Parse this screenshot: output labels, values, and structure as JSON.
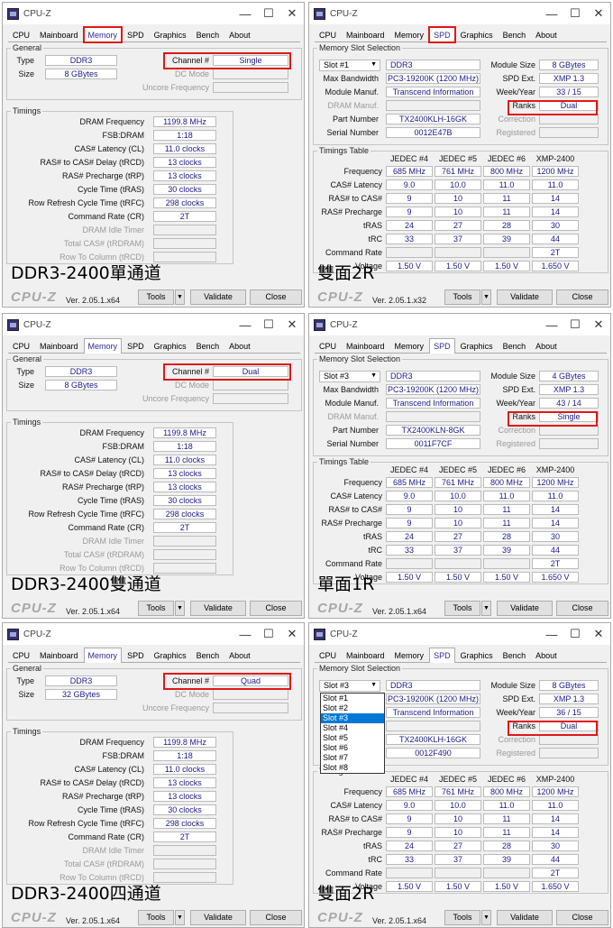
{
  "title": "CPU-Z",
  "win_controls": {
    "min": "—",
    "max": "☐",
    "close": "✕"
  },
  "tabs": [
    "CPU",
    "Mainboard",
    "Memory",
    "SPD",
    "Graphics",
    "Bench",
    "About"
  ],
  "footer": {
    "logo": "CPU-Z",
    "version": "Ver. 2.05.1.x64",
    "version_alt": "Ver. 2.05.1.x32",
    "tools": "Tools",
    "validate": "Validate",
    "close": "Close"
  },
  "mem": {
    "general": "General",
    "type_label": "Type",
    "size_label": "Size",
    "channel_label": "Channel #",
    "dc_label": "DC Mode",
    "uncore_label": "Uncore Frequency",
    "timings": "Timings",
    "t_labels": [
      "DRAM Frequency",
      "FSB:DRAM",
      "CAS# Latency (CL)",
      "RAS# to CAS# Delay (tRCD)",
      "RAS# Precharge (tRP)",
      "Cycle Time (tRAS)",
      "Row Refresh Cycle Time (tRFC)",
      "Command Rate (CR)",
      "DRAM Idle Timer",
      "Total CAS# (tRDRAM)",
      "Row To Column (tRCD)"
    ],
    "t_values": [
      "1199.8 MHz",
      "1:18",
      "11.0 clocks",
      "13 clocks",
      "13 clocks",
      "30 clocks",
      "298 clocks",
      "2T",
      "",
      "",
      ""
    ],
    "type": "DDR3",
    "panels": [
      {
        "size": "8 GBytes",
        "channel": "Single",
        "caption": "DDR3-2400單通道"
      },
      {
        "size": "8 GBytes",
        "channel": "Dual",
        "caption": "DDR3-2400雙通道"
      },
      {
        "size": "32 GBytes",
        "channel": "Quad",
        "caption": "DDR3-2400四通道"
      }
    ]
  },
  "spd": {
    "group": "Memory Slot Selection",
    "l_bw": "Max Bandwidth",
    "l_mfr": "Module Manuf.",
    "l_dram": "DRAM Manuf.",
    "l_part": "Part Number",
    "l_serial": "Serial Number",
    "l_msize": "Module Size",
    "l_ext": "SPD Ext.",
    "l_week": "Week/Year",
    "l_ranks": "Ranks",
    "l_corr": "Correction",
    "l_reg": "Registered",
    "timings": "Timings Table",
    "cols": [
      "JEDEC #4",
      "JEDEC #5",
      "JEDEC #6",
      "XMP-2400"
    ],
    "rows": [
      {
        "label": "Frequency",
        "v": [
          "685 MHz",
          "761 MHz",
          "800 MHz",
          "1200 MHz"
        ]
      },
      {
        "label": "CAS# Latency",
        "v": [
          "9.0",
          "10.0",
          "11.0",
          "11.0"
        ]
      },
      {
        "label": "RAS# to CAS#",
        "v": [
          "9",
          "10",
          "11",
          "14"
        ]
      },
      {
        "label": "RAS# Precharge",
        "v": [
          "9",
          "10",
          "11",
          "14"
        ]
      },
      {
        "label": "tRAS",
        "v": [
          "24",
          "27",
          "28",
          "30"
        ]
      },
      {
        "label": "tRC",
        "v": [
          "33",
          "37",
          "39",
          "44"
        ]
      },
      {
        "label": "Command Rate",
        "v": [
          "",
          "",
          "",
          "2T"
        ]
      },
      {
        "label": "Voltage",
        "v": [
          "1.50 V",
          "1.50 V",
          "1.50 V",
          "1.650 V"
        ]
      }
    ],
    "type": "DDR3",
    "bw": "PC3-19200K (1200 MHz)",
    "mfr": "Transcend Information",
    "ext": "XMP 1.3",
    "panels": [
      {
        "slot": "Slot #1",
        "size": "8 GBytes",
        "week": "33 / 15",
        "ranks": "Dual",
        "part": "TX2400KLH-16GK",
        "serial": "0012E47B",
        "caption": "雙面2R"
      },
      {
        "slot": "Slot #3",
        "size": "4 GBytes",
        "week": "43 / 14",
        "ranks": "Single",
        "part": "TX2400KLN-8GK",
        "serial": "0011F7CF",
        "caption": "單面1R"
      },
      {
        "slot": "Slot #3",
        "size": "8 GBytes",
        "week": "36 / 15",
        "ranks": "Dual",
        "part": "TX2400KLH-16GK",
        "serial": "0012F490",
        "caption": "雙面2R"
      }
    ],
    "dropdown": [
      "Slot #1",
      "Slot #2",
      "Slot #3",
      "Slot #4",
      "Slot #5",
      "Slot #6",
      "Slot #7",
      "Slot #8"
    ],
    "dropdown_selected": "Slot #3"
  }
}
